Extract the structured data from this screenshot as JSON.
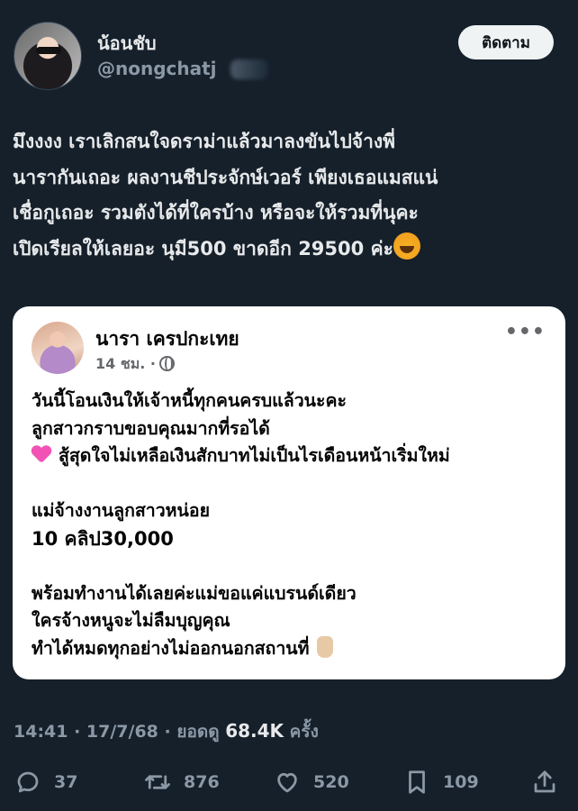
{
  "author": {
    "display_name": "น้อนชับ",
    "handle": "@nongchatj"
  },
  "follow_button": "ติดตาม",
  "tweet": {
    "lines": [
      "มึงงงง เราเลิกสนใจดราม่าแล้วมาลงขันไปจ้างพี่",
      "นารากันเถอะ ผลงานชีประจักษ์เวอร์ เพียงเธอแมสแน่",
      "เชื่อกูเถอะ รวมตังได้ที่ใครบ้าง หรือจะให้รวมที่นุคะ",
      "เปิดเรียลให้เลยอะ นุมี500 ขาดอีก 29500 ค่ะ"
    ],
    "emoji": "face-with-tears-of-joy"
  },
  "embedded_post": {
    "name": "นารา เครปกะเทย",
    "time": "14 ชม. ·",
    "more": "•••",
    "lines": [
      " วันนี้โอนเงินให้เจ้าหนี้ทุกคนครบแล้วนะคะ",
      "ลูกสาวกราบขอบคุณมากที่รอได้",
      "สู้สุดใจไม่เหลือเงินสักบาทไม่เป็นไรเดือนหน้าเริ่มใหม่",
      "",
      "แม่จ้างงานลูกสาวหน่อย",
      " 10 คลิป30,000",
      "",
      "พร้อมทำงานได้เลยค่ะแม่ขอแค่แบรนด์เดียว",
      "ใครจ้างหนูจะไม่ลืมบุญคุณ",
      "ทำได้หมดทุกอย่างไม่ออกนอกสถานที่"
    ]
  },
  "meta": {
    "time_date": "14:41 · 17/7/68 · ยอดดู ",
    "views": "68.4K",
    "views_suffix": " ครั้ง"
  },
  "actions": {
    "replies": "37",
    "reposts": "876",
    "likes": "520",
    "bookmarks": "109"
  }
}
